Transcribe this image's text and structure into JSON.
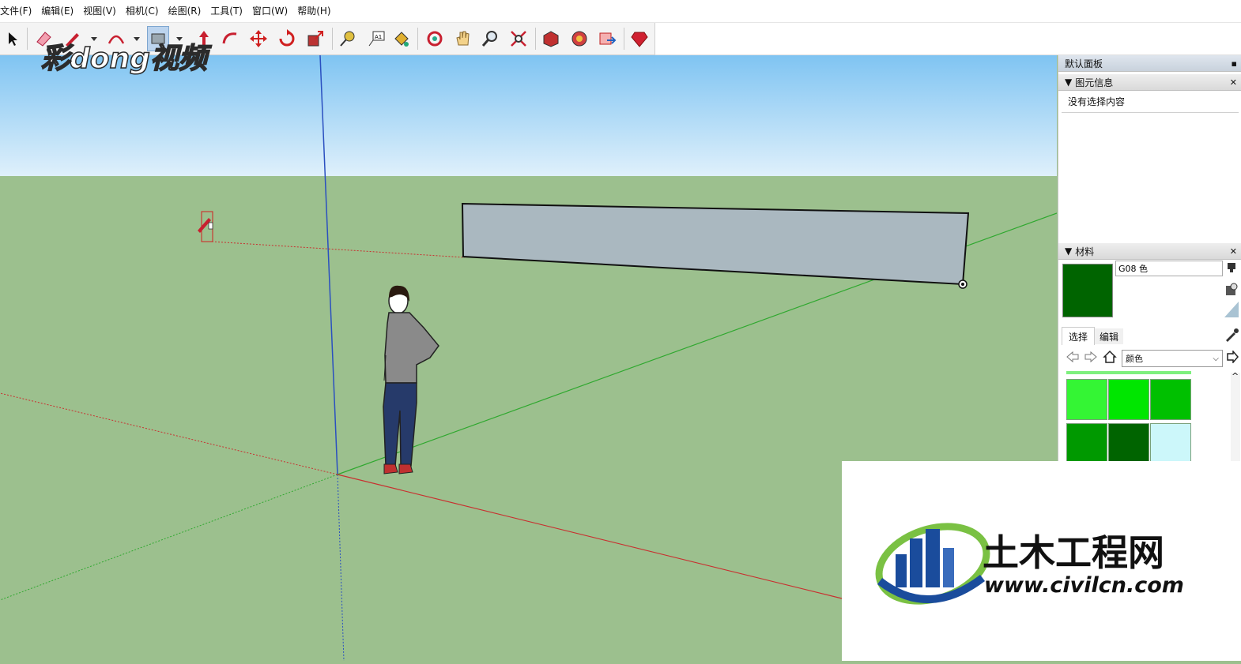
{
  "menu": [
    "文件(F)",
    "编辑(E)",
    "视图(V)",
    "相机(C)",
    "绘图(R)",
    "工具(T)",
    "窗口(W)",
    "帮助(H)"
  ],
  "watermark": {
    "text": "彩dong视频"
  },
  "tray": {
    "title": "默认面板",
    "entity_info": {
      "title": "图元信息",
      "body": "没有选择内容"
    },
    "materials": {
      "title": "材料",
      "name_value": "G08 色",
      "current_color": "#006400",
      "tabs": [
        "选择",
        "编辑"
      ],
      "library": "颜色",
      "swatches": [
        "#34f534",
        "#00e600",
        "#00c000",
        "#009900",
        "#006400",
        "#ccf7fa"
      ]
    }
  },
  "logo": {
    "name": "土木工程网",
    "url": "www.civilcn.com"
  },
  "colors": {
    "sky_top": "#7fc4f2",
    "ground": "#9cc08e",
    "rect_fill": "#aab8c0",
    "accent_blue": "#1a4c9c",
    "accent_green": "#7ac143"
  }
}
